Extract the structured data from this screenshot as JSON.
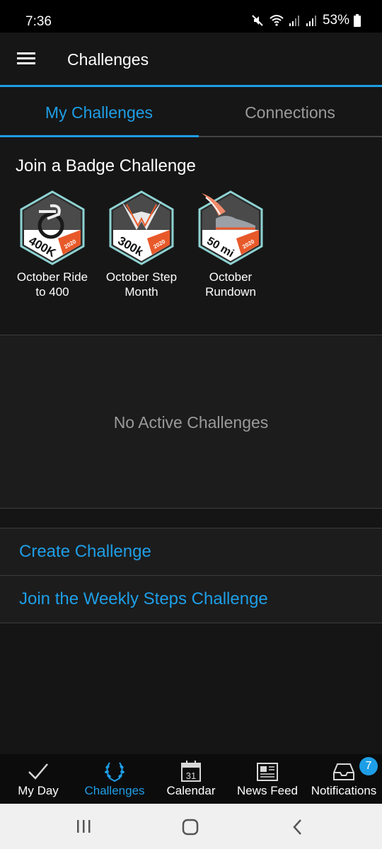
{
  "status_bar": {
    "time": "7:36",
    "battery": "53%",
    "icons": [
      "mute-icon",
      "wifi-icon",
      "signal-icon",
      "signal-icon",
      "battery-icon"
    ]
  },
  "app_bar": {
    "title": "Challenges",
    "menu_icon": "hamburger-menu-icon"
  },
  "tabs": [
    {
      "label": "My Challenges",
      "active": true
    },
    {
      "label": "Connections",
      "active": false
    }
  ],
  "badge_section": {
    "title": "Join a Badge Challenge",
    "badges": [
      {
        "label_line1": "October Ride",
        "label_line2": "to 400",
        "badge_text": "400K",
        "year": "2020"
      },
      {
        "label_line1": "October Step",
        "label_line2": "Month",
        "badge_text": "300k",
        "year": "2020"
      },
      {
        "label_line1": "October",
        "label_line2": "Rundown",
        "badge_text": "50 mi",
        "year": "2020"
      }
    ]
  },
  "empty_state": {
    "text": "No Active Challenges"
  },
  "links": [
    {
      "label": "Create Challenge"
    },
    {
      "label": "Join the Weekly Steps Challenge"
    }
  ],
  "bottom_nav": {
    "items": [
      {
        "label": "My Day",
        "icon": "checkmark-icon",
        "active": false
      },
      {
        "label": "Challenges",
        "icon": "laurel-icon",
        "active": true
      },
      {
        "label": "Calendar",
        "icon": "calendar-icon",
        "active": false,
        "icon_text": "31"
      },
      {
        "label": "News Feed",
        "icon": "newspaper-icon",
        "active": false
      },
      {
        "label": "Notifications",
        "icon": "inbox-icon",
        "active": false,
        "badge_count": "7"
      }
    ]
  },
  "colors": {
    "accent": "#1e9ee6",
    "background": "#151515",
    "badge_orange": "#e8592a"
  }
}
